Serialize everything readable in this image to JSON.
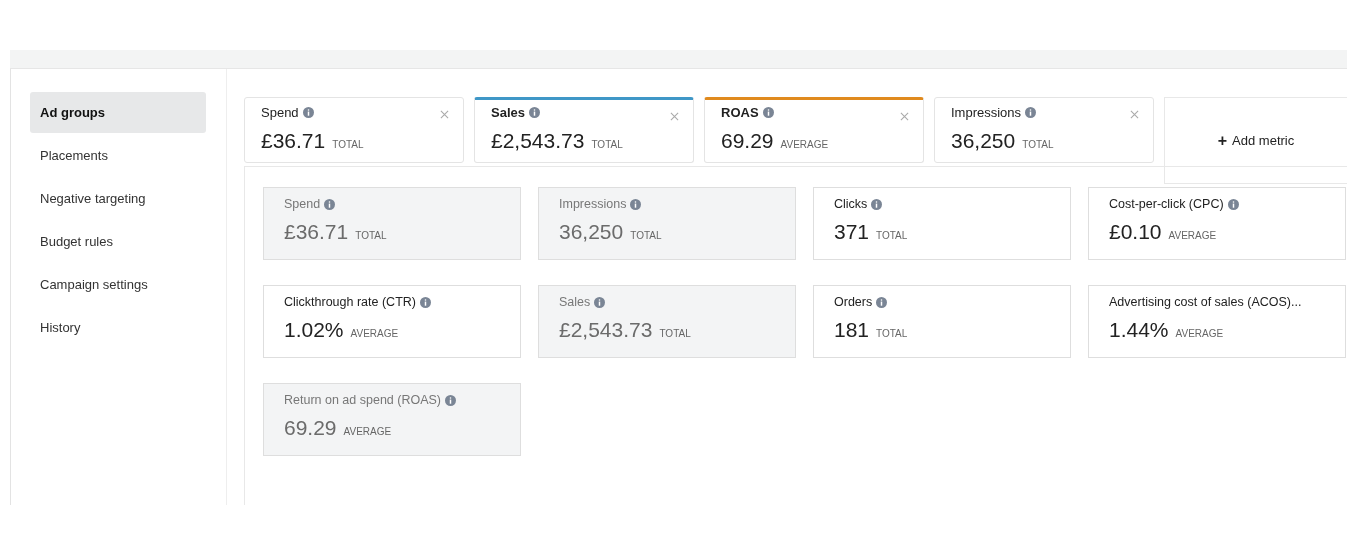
{
  "sidebar": {
    "items": [
      {
        "label": "Ad groups",
        "selected": true
      },
      {
        "label": "Placements",
        "selected": false
      },
      {
        "label": "Negative targeting",
        "selected": false
      },
      {
        "label": "Budget rules",
        "selected": false
      },
      {
        "label": "Campaign settings",
        "selected": false
      },
      {
        "label": "History",
        "selected": false
      }
    ]
  },
  "metric_chips": [
    {
      "name": "Spend",
      "value": "£36.71",
      "unit": "TOTAL"
    },
    {
      "name": "Sales",
      "value": "£2,543.73",
      "unit": "TOTAL",
      "color": "#3f97c7"
    },
    {
      "name": "ROAS",
      "value": "69.29",
      "unit": "AVERAGE",
      "color": "#e08a1e"
    },
    {
      "name": "Impressions",
      "value": "36,250",
      "unit": "TOTAL"
    }
  ],
  "add_metric": {
    "icon": "+",
    "label": "Add metric"
  },
  "metric_cards": [
    {
      "name": "Spend",
      "value": "£36.71",
      "unit": "TOTAL",
      "selected": true
    },
    {
      "name": "Impressions",
      "value": "36,250",
      "unit": "TOTAL",
      "selected": true
    },
    {
      "name": "Clicks",
      "value": "371",
      "unit": "TOTAL",
      "selected": false
    },
    {
      "name": "Cost-per-click (CPC)",
      "value": "£0.10",
      "unit": "AVERAGE",
      "selected": false
    },
    {
      "name": "Clickthrough rate (CTR)",
      "value": "1.02%",
      "unit": "AVERAGE",
      "selected": false
    },
    {
      "name": "Sales",
      "value": "£2,543.73",
      "unit": "TOTAL",
      "selected": true
    },
    {
      "name": "Orders",
      "value": "181",
      "unit": "TOTAL",
      "selected": false
    },
    {
      "name": "Advertising cost of sales (ACOS)...",
      "value": "1.44%",
      "unit": "AVERAGE",
      "selected": false,
      "info": false
    },
    {
      "name": "Return on ad spend (ROAS)",
      "value": "69.29",
      "unit": "AVERAGE",
      "selected": true
    }
  ]
}
